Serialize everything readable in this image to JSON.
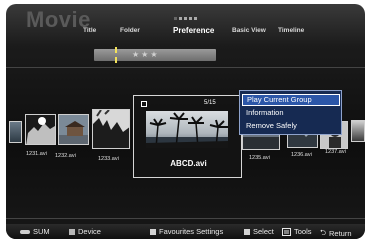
{
  "header": {
    "app_title": "Movie",
    "tabs": [
      {
        "label": "Title"
      },
      {
        "label": "Folder"
      },
      {
        "label": "Preference",
        "active": true
      },
      {
        "label": "Basic View"
      },
      {
        "label": "Timeline"
      }
    ],
    "preference_rating": "★★★"
  },
  "thumbnails": [
    {
      "name": "1231.avi"
    },
    {
      "name": "1232.avi"
    },
    {
      "name": "1233.avi"
    },
    {
      "name": "1235.avi"
    },
    {
      "name": "1236.avi"
    },
    {
      "name": "1237.avi"
    }
  ],
  "focused": {
    "name": "ABCD.avi",
    "counter": "5/15"
  },
  "tools_menu": {
    "items": [
      {
        "label": "Play Current Group",
        "selected": true
      },
      {
        "label": "Information"
      },
      {
        "label": "Remove Safely"
      }
    ]
  },
  "footer": {
    "sum": "SUM",
    "device": "Device",
    "favourites": "Favourites Settings",
    "select": "Select",
    "tools": "Tools",
    "return": "Return"
  },
  "colors": {
    "menu_bg": "#162a52",
    "menu_selected": "#2b56a8",
    "sort_cursor": "#f2e15a",
    "device_button": "#b7b7b7"
  }
}
